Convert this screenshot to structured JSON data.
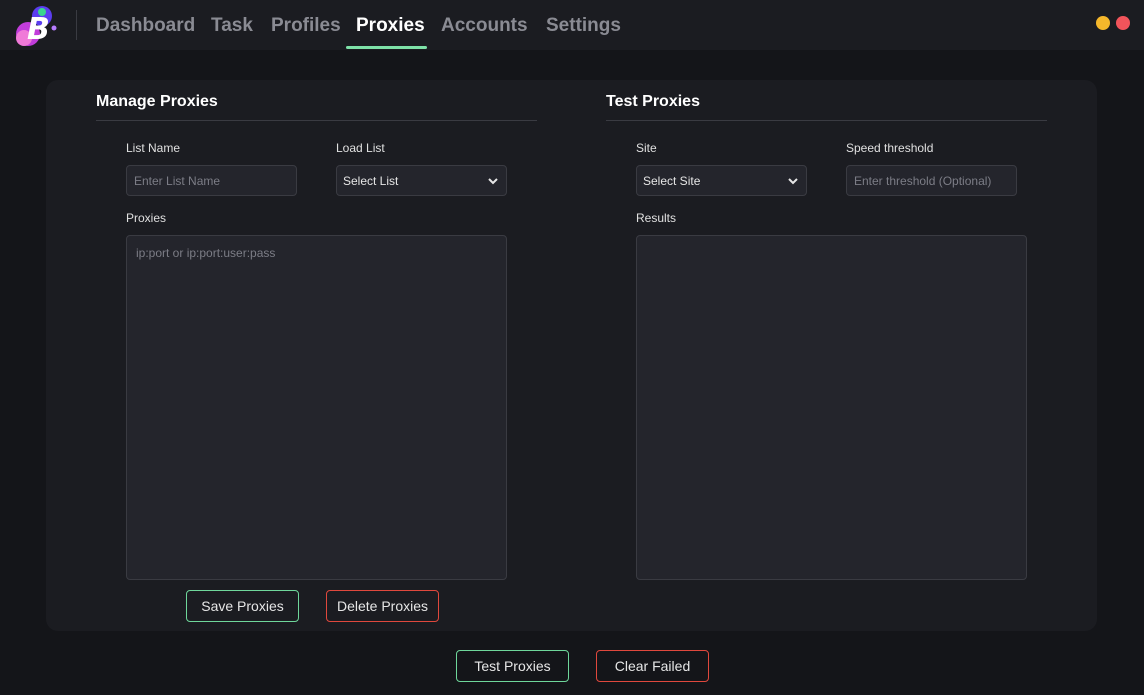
{
  "app": {
    "logo_icon": "brand-b-logo",
    "tabs": [
      {
        "label": "Dashboard",
        "active": false
      },
      {
        "label": "Task",
        "active": false
      },
      {
        "label": "Profiles",
        "active": false
      },
      {
        "label": "Proxies",
        "active": true
      },
      {
        "label": "Accounts",
        "active": false
      },
      {
        "label": "Settings",
        "active": false
      }
    ],
    "active_tab_color": "#7ee2a8",
    "window_controls": [
      {
        "name": "minimize-dot-icon",
        "color": "#f5b72b"
      },
      {
        "name": "close-dot-icon",
        "color": "#f2545b"
      }
    ]
  },
  "manage": {
    "title": "Manage Proxies",
    "list_name_label": "List Name",
    "list_name_placeholder": "Enter List Name",
    "load_list_label": "Load List",
    "load_list_value": "Select List",
    "proxies_label": "Proxies",
    "proxies_placeholder": "ip:port or ip:port:user:pass",
    "save_label": "Save Proxies",
    "delete_label": "Delete Proxies"
  },
  "test": {
    "title": "Test Proxies",
    "site_label": "Site",
    "site_value": "Select Site",
    "speed_label": "Speed threshold",
    "speed_placeholder": "Enter threshold (Optional)",
    "results_label": "Results"
  },
  "footer": {
    "test_label": "Test Proxies",
    "clear_label": "Clear Failed"
  },
  "colors": {
    "success_border": "#6fd79b",
    "danger_border": "#e0483d"
  }
}
